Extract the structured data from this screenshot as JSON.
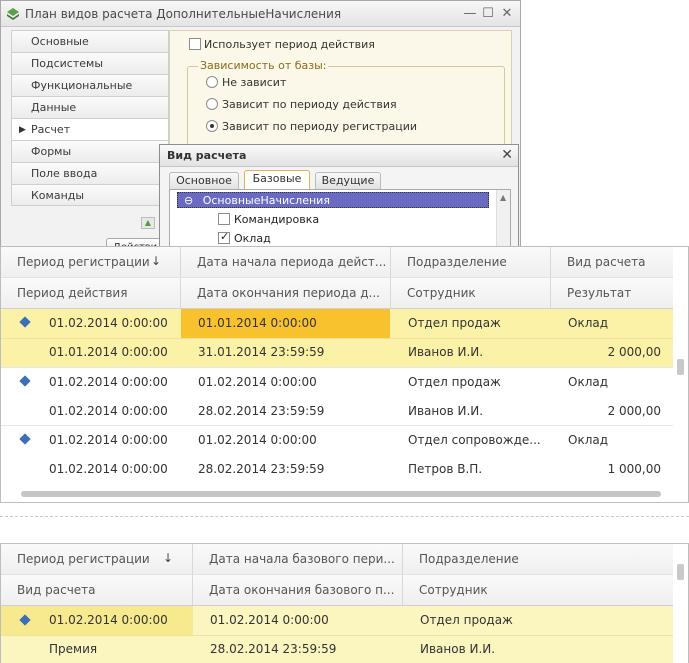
{
  "window": {
    "title": "План видов расчета ДополнительныеНачисления",
    "controls": {
      "minimize": "—",
      "maximize": "☐",
      "close": "✕"
    }
  },
  "sidebar": {
    "items": [
      {
        "label": "Основные"
      },
      {
        "label": "Подсистемы"
      },
      {
        "label": "Функциональные опции"
      },
      {
        "label": "Данные"
      },
      {
        "label": "Расчет",
        "active": true
      },
      {
        "label": "Формы"
      },
      {
        "label": "Поле ввода"
      },
      {
        "label": "Команды"
      }
    ],
    "active_marker": "▶"
  },
  "calc_panel": {
    "uses_period_label": "Использует период действия",
    "uses_period_checked": false,
    "base_dependency_title": "Зависимость от базы:",
    "options": [
      {
        "label": "Не зависит",
        "selected": false
      },
      {
        "label": "Зависит по периоду действия",
        "selected": false
      },
      {
        "label": "Зависит по периоду регистрации",
        "selected": true
      }
    ],
    "clipped_button_label": "Действи"
  },
  "dialog": {
    "title": "Вид расчета",
    "close": "✕",
    "tabs": [
      {
        "label": "Основное",
        "active": false
      },
      {
        "label": "Базовые",
        "active": true
      },
      {
        "label": "Ведущие",
        "active": false
      }
    ],
    "tree": {
      "root": "ОсновныеНачисления",
      "root_icon": "⊖",
      "children": [
        {
          "label": "Командировка",
          "checked": false
        },
        {
          "label": "Оклад",
          "checked": true
        }
      ]
    }
  },
  "table1": {
    "headers_row1": [
      "Период регистрации",
      "Дата начала периода дейст...",
      "Подразделение",
      "Вид расчета"
    ],
    "headers_row2": [
      "Период действия",
      "Дата окончания периода д...",
      "Сотрудник",
      "Результат"
    ],
    "sort_icon": "↓",
    "rows": [
      {
        "a": "01.02.2014 0:00:00",
        "b": "01.01.2014 0:00:00",
        "c": "Отдел продаж",
        "d": "Оклад",
        "a2": "01.01.2014 0:00:00",
        "b2": "31.01.2014 23:59:59",
        "c2": "Иванов И.И.",
        "d2": "2 000,00",
        "selected": true
      },
      {
        "a": "01.02.2014 0:00:00",
        "b": "01.02.2014 0:00:00",
        "c": "Отдел продаж",
        "d": "Оклад",
        "a2": "01.02.2014 0:00:00",
        "b2": "28.02.2014 23:59:59",
        "c2": "Иванов И.И.",
        "d2": "2 000,00"
      },
      {
        "a": "01.02.2014 0:00:00",
        "b": "01.02.2014 0:00:00",
        "c": "Отдел сопровожде...",
        "d": "Оклад",
        "a2": "01.02.2014 0:00:00",
        "b2": "28.02.2014 23:59:59",
        "c2": "Петров В.П.",
        "d2": "1 000,00"
      }
    ]
  },
  "table2": {
    "headers_row1": [
      "Период регистрации",
      "Дата начала базового пери...",
      "Подразделение"
    ],
    "headers_row2": [
      "Вид расчета",
      "Дата окончания базового п...",
      "Сотрудник"
    ],
    "sort_icon": "↓",
    "rows": [
      {
        "a": "01.02.2014 0:00:00",
        "b": "01.02.2014 0:00:00",
        "c": "Отдел продаж",
        "a2": "Премия",
        "b2": "28.02.2014 23:59:59",
        "c2": "Иванов И.И.",
        "selected": true
      }
    ]
  },
  "colors": {
    "selection": "#fbf2a8",
    "active_cell": "#f7c22e",
    "row_marker": "#3b6fb6",
    "tree_selection": "#6a6ac2"
  }
}
